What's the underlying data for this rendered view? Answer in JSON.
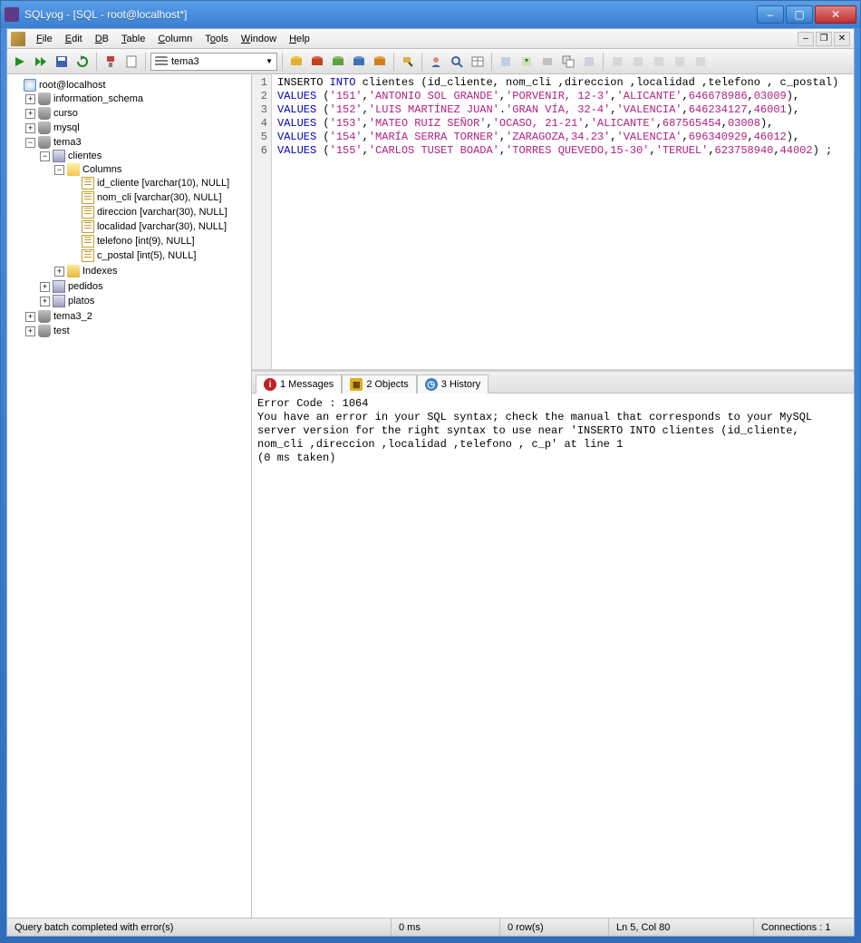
{
  "title": "SQLyog - [SQL - root@localhost*]",
  "menu": {
    "file": "File",
    "edit": "Edit",
    "db": "DB",
    "table": "Table",
    "column": "Column",
    "tools": "Tools",
    "window": "Window",
    "help": "Help"
  },
  "toolbar": {
    "current_db": "tema3"
  },
  "tree": {
    "server": "root@localhost",
    "dbs": {
      "information_schema": "information_schema",
      "curso": "curso",
      "mysql": "mysql",
      "tema3": "tema3",
      "tema3_2": "tema3_2",
      "test": "test"
    },
    "clientes": "clientes",
    "columns_label": "Columns",
    "columns": [
      "id_cliente [varchar(10), NULL]",
      "nom_cli [varchar(30), NULL]",
      "direccion [varchar(30), NULL]",
      "localidad [varchar(30), NULL]",
      "telefono [int(9), NULL]",
      "c_postal [int(5), NULL]"
    ],
    "indexes": "Indexes",
    "pedidos": "pedidos",
    "platos": "platos"
  },
  "sql": {
    "lines": [
      {
        "n": "1",
        "segs": [
          {
            "t": "INSERTO "
          },
          {
            "t": "INTO",
            "c": "kw"
          },
          {
            "t": " clientes (id_cliente, nom_cli ,direccion ,localidad ,telefono , c_postal)"
          }
        ]
      },
      {
        "n": "2",
        "segs": [
          {
            "t": "VALUES",
            "c": "kw"
          },
          {
            "t": " ("
          },
          {
            "t": "'151'",
            "c": "str"
          },
          {
            "t": ","
          },
          {
            "t": "'ANTONIO SOL GRANDE'",
            "c": "str"
          },
          {
            "t": ","
          },
          {
            "t": "'PORVENIR, 12-3'",
            "c": "str"
          },
          {
            "t": ","
          },
          {
            "t": "'ALICANTE'",
            "c": "str"
          },
          {
            "t": ","
          },
          {
            "t": "646678986",
            "c": "num"
          },
          {
            "t": ","
          },
          {
            "t": "03009",
            "c": "num"
          },
          {
            "t": "),"
          }
        ]
      },
      {
        "n": "3",
        "segs": [
          {
            "t": "VALUES",
            "c": "kw"
          },
          {
            "t": " ("
          },
          {
            "t": "'152'",
            "c": "str"
          },
          {
            "t": ","
          },
          {
            "t": "'LUIS MARTÍNEZ JUAN'",
            "c": "str"
          },
          {
            "t": "."
          },
          {
            "t": "'GRAN VÍA, 32-4'",
            "c": "str"
          },
          {
            "t": ","
          },
          {
            "t": "'VALENCIA'",
            "c": "str"
          },
          {
            "t": ","
          },
          {
            "t": "646234127",
            "c": "num"
          },
          {
            "t": ","
          },
          {
            "t": "46001",
            "c": "num"
          },
          {
            "t": "),"
          }
        ]
      },
      {
        "n": "4",
        "segs": [
          {
            "t": "VALUES",
            "c": "kw"
          },
          {
            "t": " ("
          },
          {
            "t": "'153'",
            "c": "str"
          },
          {
            "t": ","
          },
          {
            "t": "'MATEO RUIZ SEÑOR'",
            "c": "str"
          },
          {
            "t": ","
          },
          {
            "t": "'OCASO, 21-21'",
            "c": "str"
          },
          {
            "t": ","
          },
          {
            "t": "'ALICANTE'",
            "c": "str"
          },
          {
            "t": ","
          },
          {
            "t": "687565454",
            "c": "num"
          },
          {
            "t": ","
          },
          {
            "t": "03008",
            "c": "num"
          },
          {
            "t": "),"
          }
        ]
      },
      {
        "n": "5",
        "segs": [
          {
            "t": "VALUES",
            "c": "kw"
          },
          {
            "t": " ("
          },
          {
            "t": "'154'",
            "c": "str"
          },
          {
            "t": ","
          },
          {
            "t": "'MARÍA SERRA TORNER'",
            "c": "str"
          },
          {
            "t": ","
          },
          {
            "t": "'ZARAGOZA,34.23'",
            "c": "str"
          },
          {
            "t": ","
          },
          {
            "t": "'VALENCIA'",
            "c": "str"
          },
          {
            "t": ","
          },
          {
            "t": "696340929",
            "c": "num"
          },
          {
            "t": ","
          },
          {
            "t": "46012",
            "c": "num"
          },
          {
            "t": "),"
          }
        ]
      },
      {
        "n": "6",
        "segs": [
          {
            "t": "VALUES",
            "c": "kw"
          },
          {
            "t": " ("
          },
          {
            "t": "'155'",
            "c": "str"
          },
          {
            "t": ","
          },
          {
            "t": "'CARLOS TUSET BOADA'",
            "c": "str"
          },
          {
            "t": ","
          },
          {
            "t": "'TORRES QUEVEDO,15-30'",
            "c": "str"
          },
          {
            "t": ","
          },
          {
            "t": "'TERUEL'",
            "c": "str"
          },
          {
            "t": ","
          },
          {
            "t": "623758940",
            "c": "num"
          },
          {
            "t": ","
          },
          {
            "t": "44002",
            "c": "num"
          },
          {
            "t": ") ;"
          }
        ]
      }
    ]
  },
  "tabs": {
    "messages": "1 Messages",
    "objects": "2 Objects",
    "history": "3 History"
  },
  "messages": "Error Code : 1064\nYou have an error in your SQL syntax; check the manual that corresponds to your MySQL server version for the right syntax to use near 'INSERTO INTO clientes (id_cliente, nom_cli ,direccion ,localidad ,telefono , c_p' at line 1\n(0 ms taken)",
  "status": {
    "main": "Query batch completed with error(s)",
    "time": "0 ms",
    "rows": "0 row(s)",
    "pos": "Ln 5, Col 80",
    "conn": "Connections : 1"
  }
}
